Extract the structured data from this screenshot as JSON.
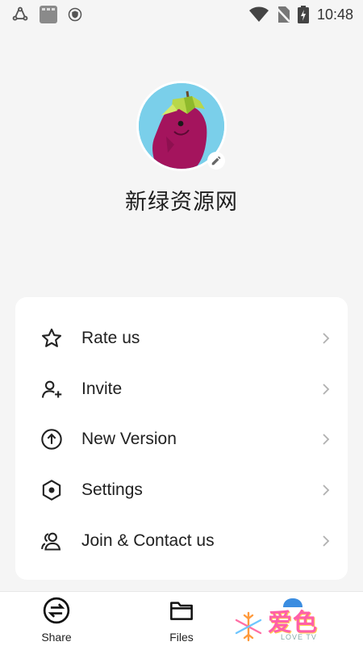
{
  "status_bar": {
    "time": "10:48",
    "icons": [
      "sync-icon",
      "app-thumb-icon",
      "shield-icon",
      "wifi-icon",
      "no-sim-icon",
      "battery-charging-icon"
    ]
  },
  "profile": {
    "username": "新绿资源网",
    "avatar": "eggplant-avatar"
  },
  "menu": {
    "items": [
      {
        "label": "Rate us",
        "icon": "star-icon"
      },
      {
        "label": "Invite",
        "icon": "add-user-icon"
      },
      {
        "label": "New Version",
        "icon": "upload-circle-icon"
      },
      {
        "label": "Settings",
        "icon": "hexagon-settings-icon"
      },
      {
        "label": "Join & Contact us",
        "icon": "group-icon"
      }
    ]
  },
  "bottom_nav": {
    "share_label": "Share",
    "files_label": "Files"
  },
  "watermark": {
    "text": "爱色",
    "sub": "LOVE TV"
  },
  "colors": {
    "background": "#f5f5f5",
    "card": "#ffffff",
    "text": "#212121",
    "chevron": "#b0b0b0"
  }
}
